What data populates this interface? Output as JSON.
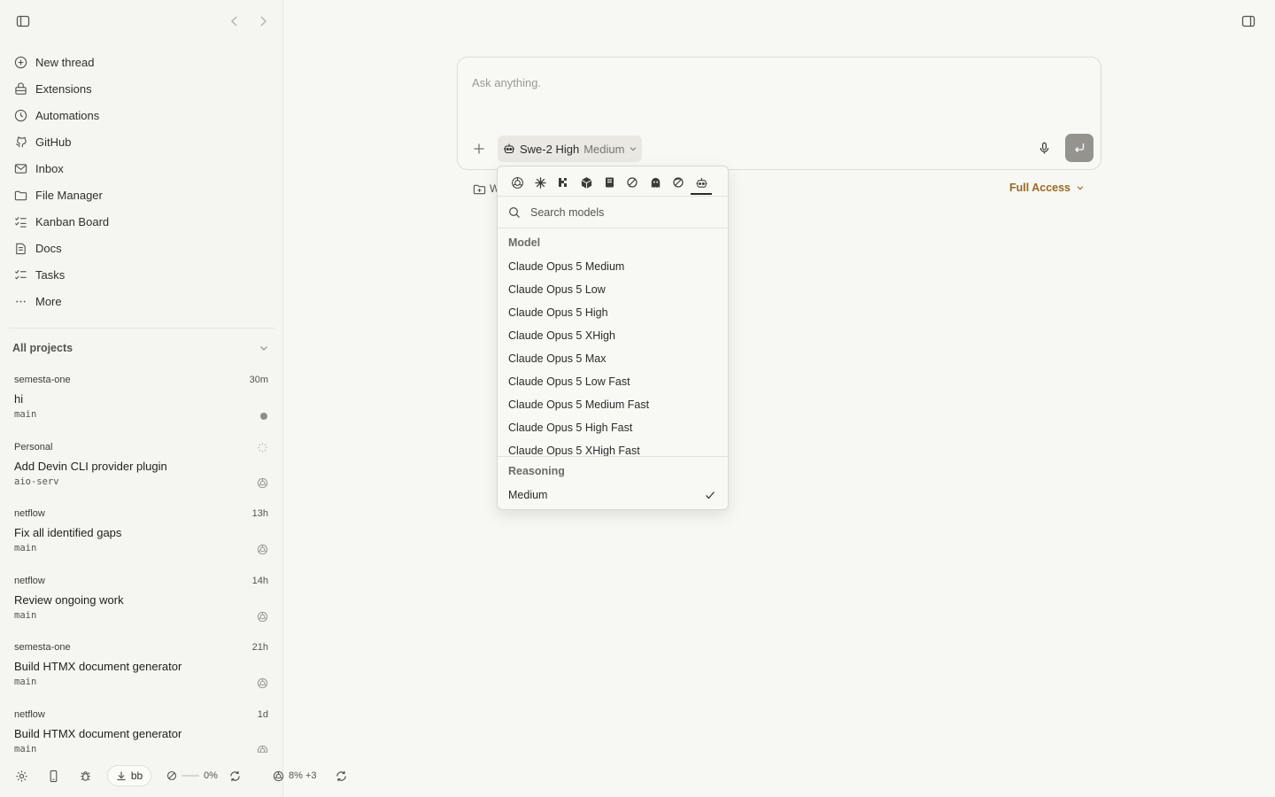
{
  "sidebar": {
    "nav": [
      {
        "label": "New thread",
        "icon": "plus-circle-icon"
      },
      {
        "label": "Extensions",
        "icon": "extensions-icon"
      },
      {
        "label": "Automations",
        "icon": "clock-icon"
      },
      {
        "label": "GitHub",
        "icon": "github-icon"
      },
      {
        "label": "Inbox",
        "icon": "mail-icon"
      },
      {
        "label": "File Manager",
        "icon": "folder-icon"
      },
      {
        "label": "Kanban Board",
        "icon": "kanban-icon"
      },
      {
        "label": "Docs",
        "icon": "docs-icon"
      },
      {
        "label": "Tasks",
        "icon": "tasks-icon"
      },
      {
        "label": "More",
        "icon": "more-icon"
      }
    ],
    "projects_label": "All projects",
    "threads": [
      {
        "project": "semesta-one",
        "time": "30m",
        "title": "hi",
        "branch": "main"
      },
      {
        "project": "Personal",
        "time": "",
        "title": "Add Devin CLI provider plugin",
        "branch": "aio-serv"
      },
      {
        "project": "netflow",
        "time": "13h",
        "title": "Fix all identified gaps",
        "branch": "main"
      },
      {
        "project": "netflow",
        "time": "14h",
        "title": "Review ongoing work",
        "branch": "main"
      },
      {
        "project": "semesta-one",
        "time": "21h",
        "title": "Build HTMX document generator",
        "branch": "main"
      },
      {
        "project": "netflow",
        "time": "1d",
        "title": "Build HTMX document generator",
        "branch": "main"
      }
    ],
    "bottom": {
      "user_label": "bb",
      "usage_percent": "0%"
    }
  },
  "main": {
    "bottom_usage": "8% +3",
    "composer": {
      "placeholder": "Ask anything.",
      "model_name": "Swe-2 High",
      "model_effort": "Medium"
    },
    "below_left_label": "W",
    "access_label": "Full Access"
  },
  "dropdown": {
    "search_placeholder": "Search models",
    "model_label": "Model",
    "models": [
      "Claude Opus 5 Medium",
      "Claude Opus 5 Low",
      "Claude Opus 5 High",
      "Claude Opus 5 XHigh",
      "Claude Opus 5 Max",
      "Claude Opus 5 Low Fast",
      "Claude Opus 5 Medium Fast",
      "Claude Opus 5 High Fast",
      "Claude Opus 5 XHigh Fast"
    ],
    "reasoning_label": "Reasoning",
    "reasoning_selected": "Medium",
    "providers": [
      "openai-icon",
      "anthropic-icon",
      "mistral-icon",
      "cube-icon",
      "book-icon",
      "cycle-icon",
      "ghost-icon",
      "cycle-alt-icon",
      "robot-icon"
    ],
    "active_provider": "robot-icon"
  },
  "colors": {
    "background": "#f7f7f3",
    "accent_access": "#9a6a1f",
    "send_button": "#94938e"
  }
}
